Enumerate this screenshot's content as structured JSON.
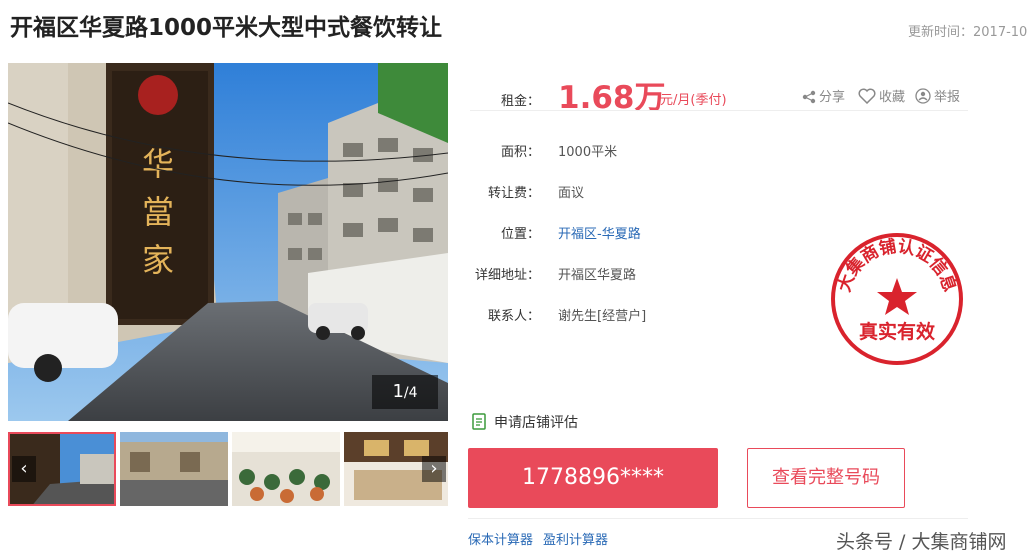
{
  "header": {
    "title": "开福区华夏路1000平米大型中式餐饮转让",
    "update_time": "更新时间：2017-10"
  },
  "gallery": {
    "counter_current": "1",
    "counter_total": "/4",
    "main_photo_sign": "华 當 家",
    "thumb_prev_icon": "‹",
    "thumb_next_icon": "›"
  },
  "rent": {
    "label": "租金：",
    "amount": "1.68万",
    "unit": "元/月(季付)"
  },
  "actions": {
    "share": "分享",
    "favorite": "收藏",
    "report": "举报"
  },
  "details": {
    "area_label": "面积：",
    "area_value": "1000平米",
    "fee_label": "转让费：",
    "fee_value": "面议",
    "location_label": "位置：",
    "location_value": "开福区-华夏路",
    "address_label": "详细地址：",
    "address_value": "开福区华夏路",
    "contact_label": "联系人：",
    "contact_value": "谢先生[经营户]"
  },
  "stamp": {
    "ring_text": "大集商铺认证信息",
    "center_text": "真实有效",
    "color": "#d9232d"
  },
  "apply_eval": "申请店铺评估",
  "phone_masked": "1778896****",
  "view_full_number": "查看完整号码",
  "calculators": {
    "bond": "保本计算器",
    "profit": "盈利计算器"
  },
  "watermark": "头条号 / 大集商铺网",
  "colors": {
    "accent": "#e94a5a",
    "link": "#2a6ab6"
  }
}
